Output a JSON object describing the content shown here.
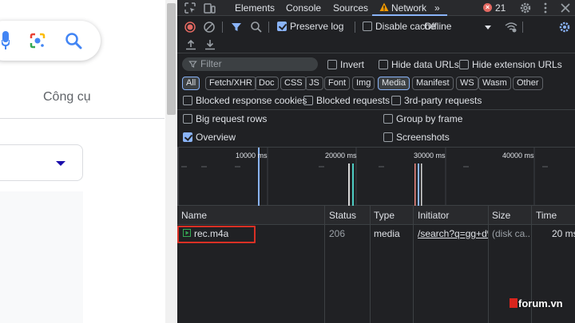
{
  "left_page": {
    "tools_label": "Công cụ"
  },
  "devtools": {
    "tabs": [
      "Elements",
      "Console",
      "Sources",
      "Network"
    ],
    "error_count": "21",
    "toolbar": {
      "preserve_log": "Preserve log",
      "disable_cache": "Disable cache",
      "throttle": "Offline"
    },
    "filter": {
      "placeholder": "Filter",
      "invert": "Invert",
      "hide_data_urls": "Hide data URLs",
      "hide_extension_urls": "Hide extension URLs"
    },
    "type_filters": [
      "All",
      "Fetch/XHR",
      "Doc",
      "CSS",
      "JS",
      "Font",
      "Img",
      "Media",
      "Manifest",
      "WS",
      "Wasm",
      "Other"
    ],
    "selected_type": "Media",
    "options": {
      "blocked_cookies": "Blocked response cookies",
      "blocked_requests": "Blocked requests",
      "third_party": "3rd-party requests",
      "big_rows": "Big request rows",
      "group_by_frame": "Group by frame",
      "overview": "Overview",
      "screenshots": "Screenshots"
    },
    "timeline_ticks": [
      "10000 ms",
      "20000 ms",
      "30000 ms",
      "40000 ms"
    ],
    "columns": [
      "Name",
      "Status",
      "Type",
      "Initiator",
      "Size",
      "Time"
    ],
    "rows": [
      {
        "name": "rec.m4a",
        "status": "206",
        "type": "media",
        "initiator": "/search?q=gg+d%",
        "size": "(disk ca...",
        "time": "20 ms"
      }
    ]
  },
  "watermark": "forum.vn",
  "colors": {
    "accent": "#8ab4f8",
    "error": "#e46962",
    "highlight": "#d93025"
  }
}
